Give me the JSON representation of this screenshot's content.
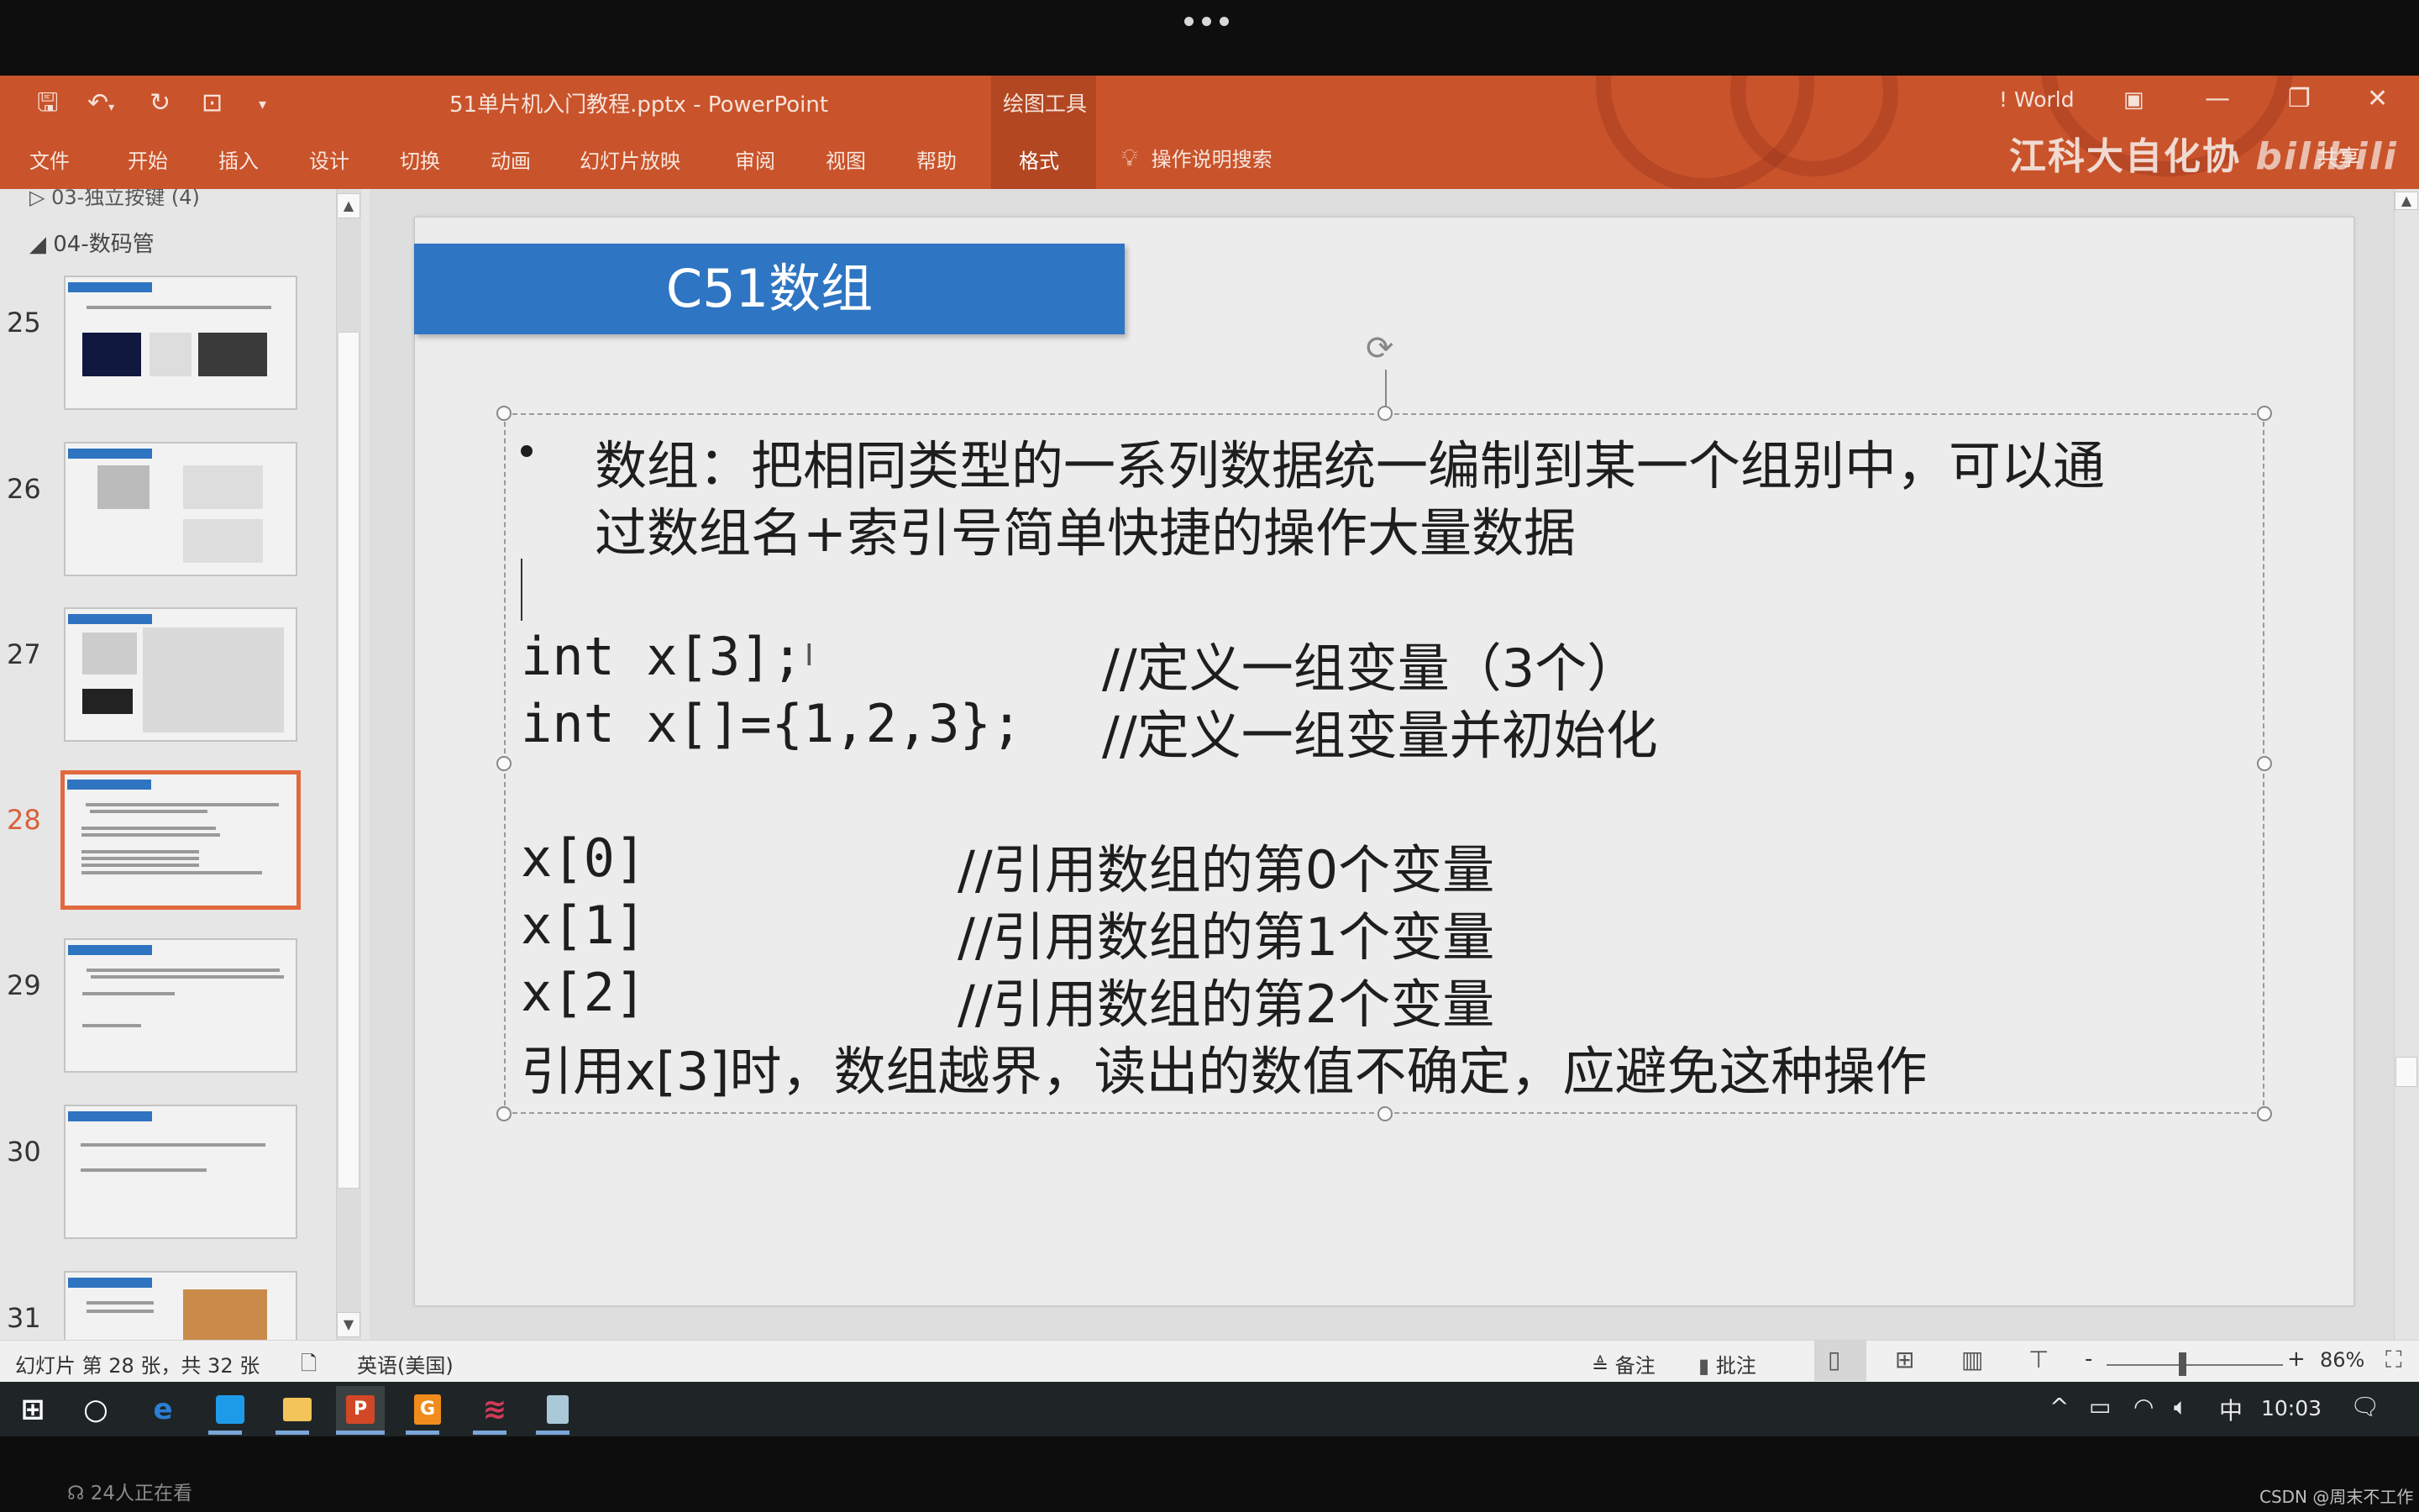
{
  "app": {
    "document_title": "51单片机入门教程.pptx  -  PowerPoint",
    "context_tool": "绘图工具",
    "account": "! World",
    "tell_me": "操作说明搜索",
    "share": "共享",
    "overlay_brand": "江科大自化协",
    "overlay_logo": "bilibili",
    "accent_color": "#c9532b"
  },
  "quick_access": {
    "save_icon": "save-icon",
    "undo_icon": "undo-icon",
    "redo_icon": "redo-icon",
    "present_icon": "present-from-start-icon",
    "customize_icon": "customize-qat-icon"
  },
  "ribbon_tabs": [
    "文件",
    "开始",
    "插入",
    "设计",
    "切换",
    "动画",
    "幻灯片放映",
    "审阅",
    "视图",
    "帮助",
    "格式"
  ],
  "window_controls": {
    "ribbon_display": "▣",
    "minimize": "—",
    "restore": "❐",
    "close": "✕"
  },
  "slide_panel": {
    "prev_section": "03-独立按键 (4)",
    "current_section": "04-数码管",
    "slides": [
      {
        "number": "25",
        "selected": false
      },
      {
        "number": "26",
        "selected": false
      },
      {
        "number": "27",
        "selected": false
      },
      {
        "number": "28",
        "selected": true
      },
      {
        "number": "29",
        "selected": false
      },
      {
        "number": "30",
        "selected": false
      },
      {
        "number": "31",
        "selected": false
      }
    ]
  },
  "slide": {
    "title": "C51数组",
    "title_bar_color": "#2e75c3",
    "bullet_line1": "数组：把相同类型的一系列数据统一编制到某一个组别中，可以通",
    "bullet_line2": "过数组名+索引号简单快捷的操作大量数据",
    "code_lines": [
      {
        "code": "int x[3];",
        "comment": "//定义一组变量（3个）"
      },
      {
        "code": "int x[]={1,2,3};",
        "comment": "//定义一组变量并初始化"
      },
      {
        "code": "x[0]",
        "comment": "//引用数组的第0个变量"
      },
      {
        "code": "x[1]",
        "comment": "//引用数组的第1个变量"
      },
      {
        "code": "x[2]",
        "comment": "//引用数组的第2个变量"
      }
    ],
    "warning_line": "引用x[3]时，数组越界，读出的数值不确定，应避免这种操作"
  },
  "status_bar": {
    "slide_counter": "幻灯片 第 28 张，共 32 张",
    "language": "英语(美国)",
    "notes": "备注",
    "comments": "批注",
    "zoom_level": "86%",
    "zoom_fraction": 0.43,
    "minus": "-",
    "plus": "+"
  },
  "taskbar": {
    "apps": [
      "start",
      "cortana",
      "edge",
      "app-blue",
      "file-explorer",
      "powerpoint",
      "app-orange",
      "app-red",
      "app-notes"
    ],
    "ime": "中",
    "time": "10:03"
  },
  "stream": {
    "viewers": "24人正在看",
    "watermark": "CSDN @周末不工作"
  }
}
